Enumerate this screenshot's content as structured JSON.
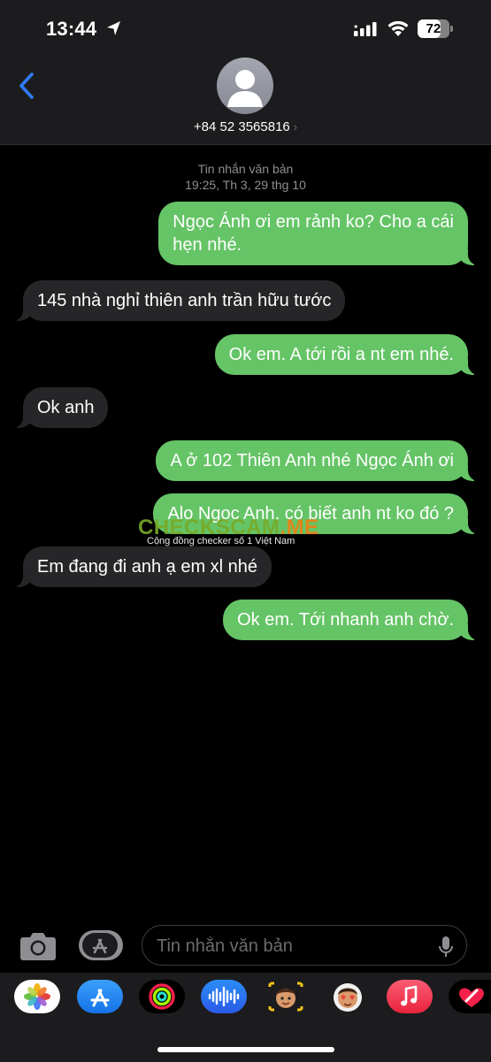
{
  "status_bar": {
    "time": "13:44",
    "battery": "72",
    "battery_level": 0.72,
    "icons": [
      "location-arrow-icon",
      "cellular-signal-icon",
      "wifi-icon",
      "battery-icon"
    ]
  },
  "header": {
    "back_icon": "chevron-left-icon",
    "avatar_icon": "person-silhouette-icon",
    "contact": "+84 52 3565816",
    "contact_chevron": "›"
  },
  "conversation": {
    "service_label": "Tin nhắn văn bản",
    "timestamp": "19:25, Th 3, 29 thg 10",
    "messages": [
      {
        "direction": "sent",
        "lines": [
          "Ngọc Ánh ơi em rảnh ko? Cho a cái",
          "hẹn nhé."
        ]
      },
      {
        "direction": "received",
        "lines": [
          "145 nhà nghỉ thiên anh trần hữu tước"
        ]
      },
      {
        "direction": "sent",
        "lines": [
          "Ok em. A tới rồi a nt em nhé."
        ]
      },
      {
        "direction": "received",
        "lines": [
          "Ok anh"
        ]
      },
      {
        "direction": "sent",
        "lines": [
          "A ở 102 Thiên Anh nhé Ngọc Ánh ơi"
        ]
      },
      {
        "direction": "sent",
        "lines": [
          "Alo Ngọc Anh, có biết anh nt ko đó ?"
        ]
      },
      {
        "direction": "received",
        "lines": [
          "Em đang đi anh ạ em xl nhé"
        ]
      },
      {
        "direction": "sent",
        "lines": [
          "Ok em. Tới nhanh anh chờ."
        ]
      }
    ]
  },
  "watermark": {
    "main": "CHECKSCAM",
    "accent": ".ME",
    "sub": "Cộng đồng checker số 1 Việt Nam"
  },
  "input_bar": {
    "placeholder": "Tin nhắn văn bản",
    "value": "",
    "icons": [
      "camera-icon",
      "app-store-icon",
      "microphone-icon"
    ]
  },
  "app_strip": {
    "apps": [
      "photos-app-icon",
      "app-store-app-icon",
      "fitness-app-icon",
      "audio-message-app-icon",
      "memoji-stickers-app-icon",
      "animoji-app-icon",
      "music-app-icon",
      "digital-touch-app-icon"
    ]
  },
  "colors": {
    "sent_bubble": "#65c466",
    "received_bubble": "#262628",
    "accent_blue": "#2f7cf6",
    "background": "#000000"
  }
}
